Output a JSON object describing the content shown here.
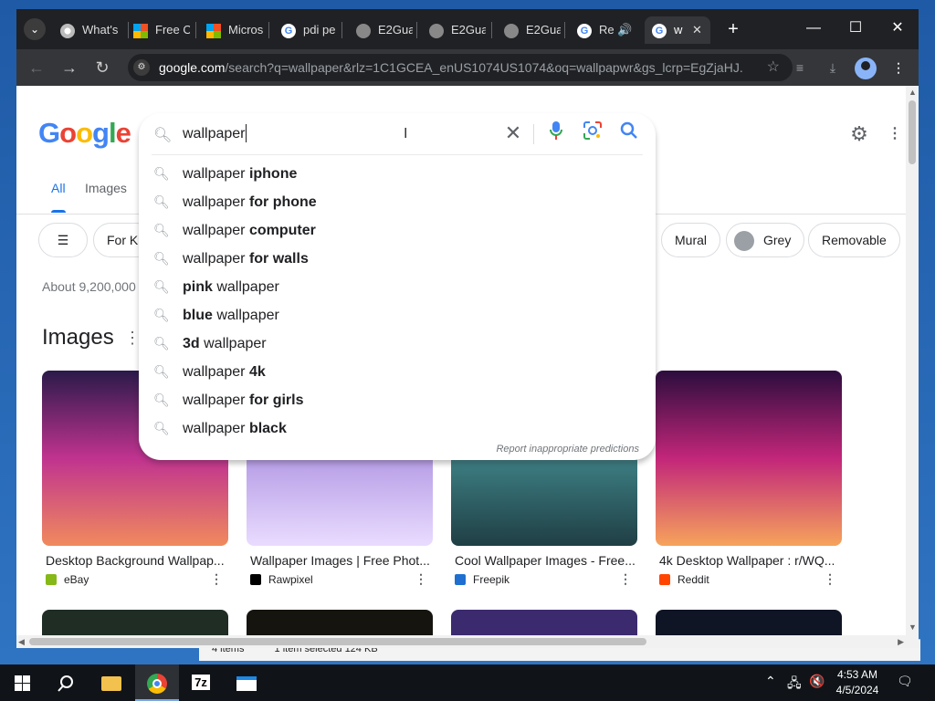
{
  "browser": {
    "tabs": [
      {
        "label": "What's",
        "icon": "chrome-icon"
      },
      {
        "label": "Free O",
        "icon": "microsoft-icon"
      },
      {
        "label": "Micros",
        "icon": "microsoft-icon"
      },
      {
        "label": "pdi pe",
        "icon": "google-icon"
      },
      {
        "label": "E2Gua",
        "icon": "e2guardian-icon"
      },
      {
        "label": "E2Gua",
        "icon": "e2guardian-icon"
      },
      {
        "label": "E2Gua",
        "icon": "e2guardian-icon"
      },
      {
        "label": "Re",
        "icon": "google-icon",
        "audio": "speaker-icon"
      },
      {
        "label": "w",
        "icon": "google-icon",
        "active": true
      }
    ],
    "url_host": "google.com",
    "url_rest": "/search?q=wallpaper&rlz=1C1GCEA_enUS1074US1074&oq=wallpapwr&gs_lcrp=EgZjaHJ..."
  },
  "search": {
    "query": "wallpaper",
    "suggestions": [
      {
        "plain": "wallpaper ",
        "bold": "iphone",
        "bold_first": false
      },
      {
        "plain": "wallpaper ",
        "bold": "for phone",
        "bold_first": false
      },
      {
        "plain": "wallpaper ",
        "bold": "computer",
        "bold_first": false
      },
      {
        "plain": "wallpaper ",
        "bold": "for walls",
        "bold_first": false
      },
      {
        "plain": " wallpaper",
        "bold": "pink",
        "bold_first": true
      },
      {
        "plain": " wallpaper",
        "bold": "blue",
        "bold_first": true
      },
      {
        "plain": " wallpaper",
        "bold": "3d",
        "bold_first": true
      },
      {
        "plain": "wallpaper ",
        "bold": "4k",
        "bold_first": false
      },
      {
        "plain": "wallpaper ",
        "bold": "for girls",
        "bold_first": false
      },
      {
        "plain": "wallpaper ",
        "bold": "black",
        "bold_first": false
      }
    ],
    "report_text": "Report inappropriate predictions"
  },
  "page": {
    "tabs": {
      "all": "All",
      "images": "Images"
    },
    "chips": {
      "first": "For Ki",
      "mural": "Mural",
      "grey": "Grey",
      "removable": "Removable"
    },
    "result_stats": "About 9,200,000",
    "images_heading": "Images",
    "images": [
      {
        "title": "Desktop Background Wallpap...",
        "source": "eBay",
        "colors": [
          "#2a1a4a",
          "#c0338f",
          "#f08a5d"
        ]
      },
      {
        "title": "Wallpaper Images | Free Phot...",
        "source": "Rawpixel",
        "colors": [
          "#5b3d8f",
          "#b79de6",
          "#e9dcff"
        ]
      },
      {
        "title": "Cool Wallpaper Images - Free...",
        "source": "Freepik",
        "colors": [
          "#a7cfd6",
          "#3d7f84",
          "#1f3f44"
        ]
      },
      {
        "title": "4k Desktop Wallpaper : r/WQ...",
        "source": "Reddit",
        "colors": [
          "#2b0d3d",
          "#c2267a",
          "#f6a35b"
        ]
      }
    ]
  },
  "taskbar": {
    "time": "4:53 AM",
    "date": "4/5/2024",
    "apps": [
      "windows-start",
      "search",
      "file-explorer",
      "chrome",
      "7zip",
      "app"
    ]
  },
  "background_window": {
    "items": "4 items",
    "selected": "1 item selected  124 KB"
  }
}
